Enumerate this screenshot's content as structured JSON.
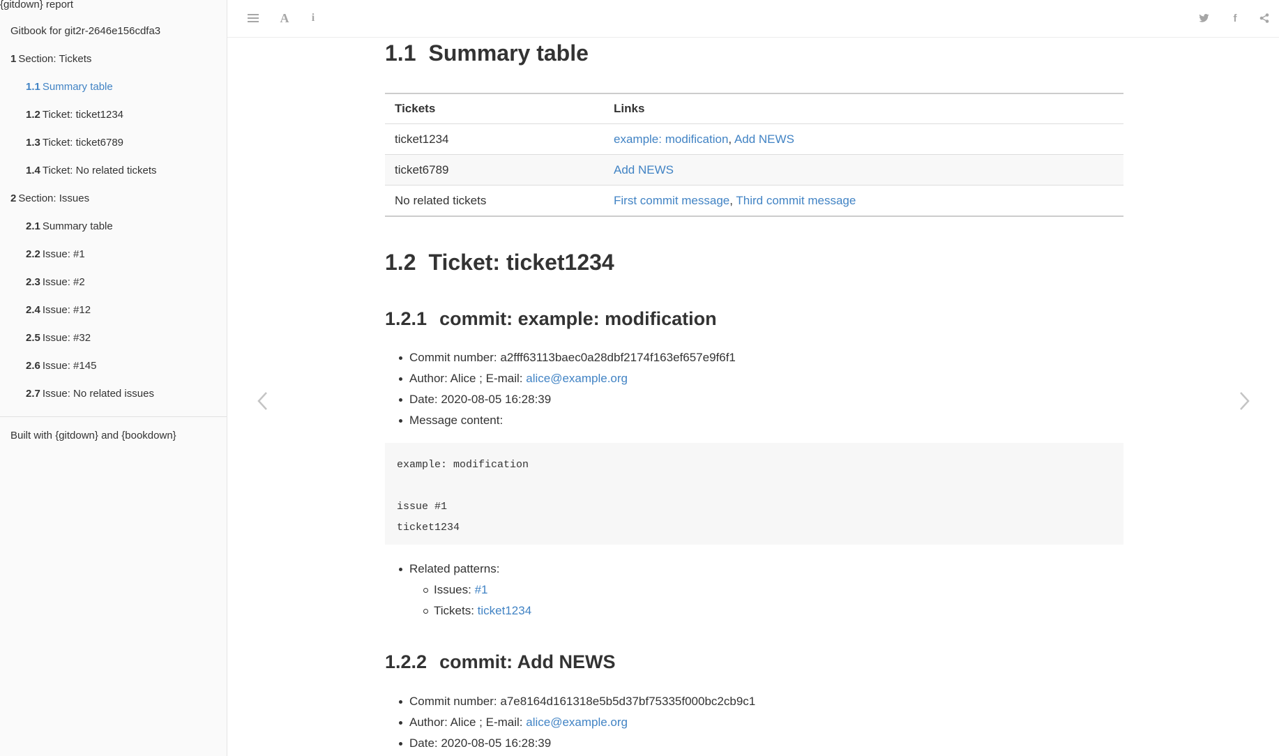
{
  "sidebar": {
    "brand": "{gitdown} report",
    "items": [
      {
        "num": "",
        "label": "Gitbook for git2r-2646e156cdfa3",
        "level": 0
      },
      {
        "num": "1",
        "label": "Section: Tickets",
        "level": 1
      },
      {
        "num": "1.1",
        "label": "Summary table",
        "level": 2
      },
      {
        "num": "1.2",
        "label": "Ticket: ticket1234",
        "level": 2
      },
      {
        "num": "1.3",
        "label": "Ticket: ticket6789",
        "level": 2
      },
      {
        "num": "1.4",
        "label": "Ticket: No related tickets",
        "level": 2
      },
      {
        "num": "2",
        "label": "Section: Issues",
        "level": 1
      },
      {
        "num": "2.1",
        "label": "Summary table",
        "level": 2
      },
      {
        "num": "2.2",
        "label": "Issue: #1",
        "level": 2
      },
      {
        "num": "2.3",
        "label": "Issue: #2",
        "level": 2
      },
      {
        "num": "2.4",
        "label": "Issue: #12",
        "level": 2
      },
      {
        "num": "2.5",
        "label": "Issue: #32",
        "level": 2
      },
      {
        "num": "2.6",
        "label": "Issue: #145",
        "level": 2
      },
      {
        "num": "2.7",
        "label": "Issue: No related issues",
        "level": 2
      }
    ],
    "built_with": "Built with {gitdown} and {bookdown}"
  },
  "toolbar": {
    "icons": [
      "menu-icon",
      "font-icon",
      "info-icon",
      "twitter-icon",
      "facebook-icon",
      "share-icon"
    ],
    "font_glyph": "A",
    "info_glyph": "i",
    "facebook_glyph": "f"
  },
  "accent_color": "#4183c4",
  "content": {
    "sec_1_1": {
      "num": "1.1",
      "title": "Summary table"
    },
    "table": {
      "headers": [
        "Tickets",
        "Links"
      ],
      "rows": [
        {
          "ticket": "ticket1234",
          "links": [
            "example: modification",
            "Add NEWS"
          ]
        },
        {
          "ticket": "ticket6789",
          "links": [
            "Add NEWS"
          ]
        },
        {
          "ticket": "No related tickets",
          "links": [
            "First commit message",
            "Third commit message"
          ]
        }
      ],
      "separator": ", "
    },
    "sec_1_2": {
      "num": "1.2",
      "title": "Ticket: ticket1234"
    },
    "sec_1_2_1": {
      "num": "1.2.1",
      "title": "commit: example: modification",
      "commit_label": "Commit number: ",
      "commit": "a2fff63113baec0a28dbf2174f163ef657e9f6f1",
      "author_label": "Author: Alice ; E-mail: ",
      "email": "alice@example.org",
      "date": "Date: 2020-08-05 16:28:39",
      "message_label": "Message content:",
      "code_lines": [
        "example: modification",
        "",
        "issue #1",
        "ticket1234"
      ],
      "related_label": "Related patterns:",
      "issues_label": "Issues: ",
      "issues_link": "#1",
      "tickets_label": "Tickets: ",
      "tickets_link": "ticket1234"
    },
    "sec_1_2_2": {
      "num": "1.2.2",
      "title": "commit: Add NEWS",
      "commit_label": "Commit number: ",
      "commit": "a7e8164d161318e5b5d37bf75335f000bc2cb9c1",
      "author_label": "Author: Alice ; E-mail: ",
      "email": "alice@example.org",
      "date": "Date: 2020-08-05 16:28:39"
    }
  }
}
